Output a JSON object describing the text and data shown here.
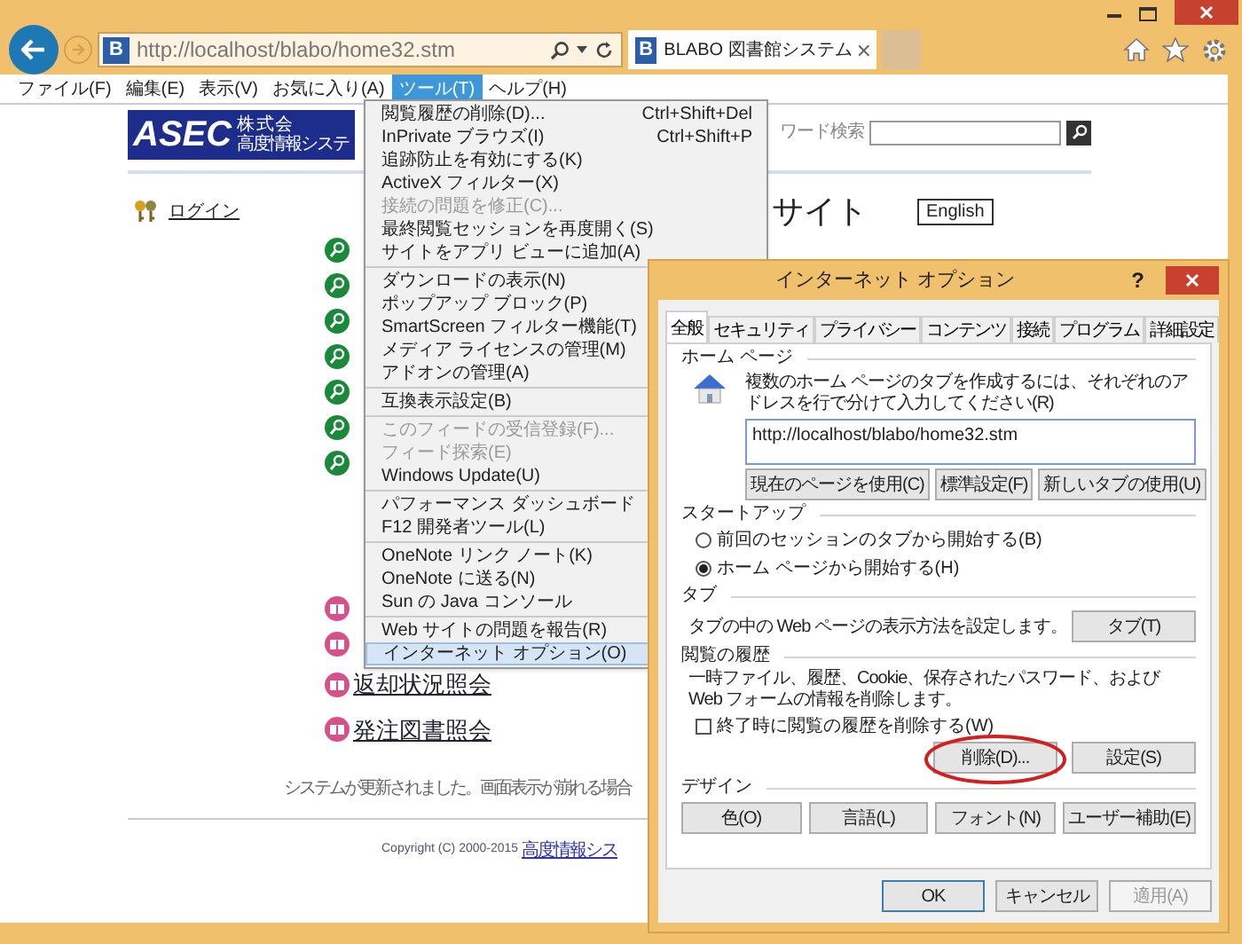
{
  "browser": {
    "address_icon": "B",
    "address": "http://localhost/blabo/home32.stm",
    "tab_icon": "B",
    "tab_title": "BLABO 図書館システム"
  },
  "menu_bar": [
    {
      "label": "ファイル(F)",
      "selected": false
    },
    {
      "label": "編集(E)",
      "selected": false
    },
    {
      "label": "表示(V)",
      "selected": false
    },
    {
      "label": "お気に入り(A)",
      "selected": false
    },
    {
      "label": "ツール(T)",
      "selected": true
    },
    {
      "label": "ヘルプ(H)",
      "selected": false
    }
  ],
  "page": {
    "logo": {
      "mark": "ASEC",
      "line1": "株 式 会",
      "line2": "高度情報システ"
    },
    "search_label": "ワード検索",
    "heading": "サイト",
    "language_button": "English",
    "login_link": "ログイン",
    "links": [
      {
        "label": "返却状況照会"
      },
      {
        "label": "発注図書照会"
      }
    ],
    "notice": "システムが更新されました。画面表示が崩れる場合",
    "copyright": "Copyright (C) 2000-2015",
    "copyright_link": "高度情報シス"
  },
  "tools_menu": [
    [
      {
        "label": "閲覧履歴の削除(D)...",
        "shortcut": "Ctrl+Shift+Del",
        "disabled": false,
        "selected": false
      },
      {
        "label": "InPrivate ブラウズ(I)",
        "shortcut": "Ctrl+Shift+P",
        "disabled": false,
        "selected": false
      },
      {
        "label": "追跡防止を有効にする(K)",
        "disabled": false,
        "selected": false
      },
      {
        "label": "ActiveX フィルター(X)",
        "disabled": false,
        "selected": false
      },
      {
        "label": "接続の問題を修正(C)...",
        "disabled": true,
        "selected": false
      },
      {
        "label": "最終閲覧セッションを再度開く(S)",
        "disabled": false,
        "selected": false
      },
      {
        "label": "サイトをアプリ ビューに追加(A)",
        "disabled": false,
        "selected": false
      }
    ],
    [
      {
        "label": "ダウンロードの表示(N)",
        "disabled": false,
        "selected": false
      },
      {
        "label": "ポップアップ ブロック(P)",
        "disabled": false,
        "selected": false
      },
      {
        "label": "SmartScreen フィルター機能(T)",
        "disabled": false,
        "selected": false
      },
      {
        "label": "メディア ライセンスの管理(M)",
        "disabled": false,
        "selected": false
      },
      {
        "label": "アドオンの管理(A)",
        "disabled": false,
        "selected": false
      }
    ],
    [
      {
        "label": "互換表示設定(B)",
        "disabled": false,
        "selected": false
      }
    ],
    [
      {
        "label": "このフィードの受信登録(F)...",
        "disabled": true,
        "selected": false
      },
      {
        "label": "フィード探索(E)",
        "disabled": true,
        "selected": false
      },
      {
        "label": "Windows Update(U)",
        "disabled": false,
        "selected": false
      }
    ],
    [
      {
        "label": "パフォーマンス ダッシュボード",
        "disabled": false,
        "selected": false
      },
      {
        "label": "F12 開発者ツール(L)",
        "disabled": false,
        "selected": false
      }
    ],
    [
      {
        "label": "OneNote リンク ノート(K)",
        "disabled": false,
        "selected": false
      },
      {
        "label": "OneNote に送る(N)",
        "disabled": false,
        "selected": false
      },
      {
        "label": "Sun の Java コンソール",
        "disabled": false,
        "selected": false
      }
    ],
    [
      {
        "label": "Web サイトの問題を報告(R)",
        "disabled": false,
        "selected": false
      },
      {
        "label": "インターネット オプション(O)",
        "disabled": false,
        "selected": true
      }
    ]
  ],
  "dialog": {
    "title": "インターネット オプション",
    "help": "?",
    "tabs": [
      {
        "label": "全般",
        "selected": true
      },
      {
        "label": "セキュリティ",
        "selected": false
      },
      {
        "label": "プライバシー",
        "selected": false
      },
      {
        "label": "コンテンツ",
        "selected": false
      },
      {
        "label": "接続",
        "selected": false
      },
      {
        "label": "プログラム",
        "selected": false
      },
      {
        "label": "詳細設定",
        "selected": false
      }
    ],
    "home_page": {
      "heading": "ホーム ページ",
      "instruction": "複数のホーム ページのタブを作成するには、それぞれのアドレスを行で分けて入力してください(R)",
      "value": "http://localhost/blabo/home32.stm",
      "buttons": [
        "現在のページを使用(C)",
        "標準設定(F)",
        "新しいタブの使用(U)"
      ]
    },
    "startup": {
      "heading": "スタートアップ",
      "options": [
        {
          "label": "前回のセッションのタブから開始する(B)",
          "selected": false
        },
        {
          "label": "ホーム ページから開始する(H)",
          "selected": true
        }
      ]
    },
    "tabs_section": {
      "heading": "タブ",
      "description": "タブの中の Web ページの表示方法を設定します。",
      "button": "タブ(T)"
    },
    "history": {
      "heading": "閲覧の履歴",
      "description": "一時ファイル、履歴、Cookie、保存されたパスワード、および Web フォームの情報を削除します。",
      "checkbox": {
        "label": "終了時に閲覧の履歴を削除する(W)",
        "checked": false
      },
      "buttons": [
        {
          "label": "削除(D)...",
          "circled": true
        },
        {
          "label": "設定(S)",
          "circled": false
        }
      ]
    },
    "design": {
      "heading": "デザイン",
      "buttons": [
        "色(O)",
        "言語(L)",
        "フォント(N)",
        "ユーザー補助(E)"
      ]
    },
    "footer_buttons": [
      {
        "label": "OK",
        "disabled": false,
        "selected": true
      },
      {
        "label": "キャンセル",
        "disabled": false,
        "selected": false
      },
      {
        "label": "適用(A)",
        "disabled": true,
        "selected": false
      }
    ]
  }
}
